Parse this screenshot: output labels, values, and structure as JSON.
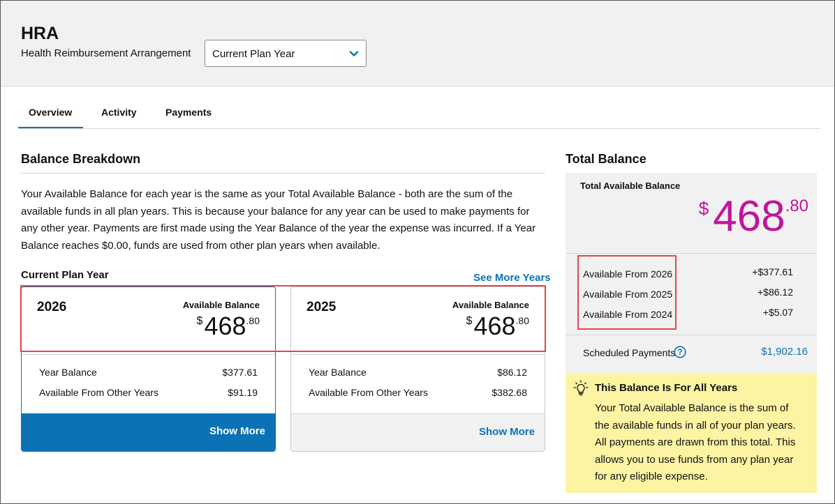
{
  "header": {
    "title": "HRA",
    "subtitle": "Health Reimbursement Arrangement",
    "plan_select": {
      "value": "Current Plan Year",
      "icon": "chevron-down-icon"
    }
  },
  "tabs": [
    {
      "label": "Overview",
      "active": true
    },
    {
      "label": "Activity",
      "active": false
    },
    {
      "label": "Payments",
      "active": false
    }
  ],
  "balance_breakdown": {
    "title": "Balance Breakdown",
    "description": "Your Available Balance for each year is the same as your Total Available Balance - both are the sum of the available funds in all plan years. This is because your balance for any year can be used to make payments for any other year. Payments are first made using the Year Balance of the year the expense was incurred. If a Year Balance reaches $0.00, funds are used from other plan years when available.",
    "current_plan_year_label": "Current Plan Year",
    "see_more_years": "See More Years",
    "cards": [
      {
        "year": "2026",
        "available_label": "Available Balance",
        "currency": "$",
        "amount_whole": "468",
        "amount_cents": ".80",
        "rows": [
          {
            "label": "Year Balance",
            "value": "$377.61"
          },
          {
            "label": "Available From Other Years",
            "value": "$91.19"
          }
        ],
        "show_more": "Show More",
        "selected": true
      },
      {
        "year": "2025",
        "available_label": "Available Balance",
        "currency": "$",
        "amount_whole": "468",
        "amount_cents": ".80",
        "rows": [
          {
            "label": "Year Balance",
            "value": "$86.12"
          },
          {
            "label": "Available From Other Years",
            "value": "$382.68"
          }
        ],
        "show_more": "Show More",
        "selected": false
      }
    ]
  },
  "total_balance": {
    "title": "Total Balance",
    "label": "Total Available Balance",
    "currency": "$",
    "amount_whole": "468",
    "amount_cents": ".80",
    "available_from": [
      {
        "label": "Available From 2026",
        "value": "+$377.61"
      },
      {
        "label": "Available From 2025",
        "value": "+$86.12"
      },
      {
        "label": "Available From 2024",
        "value": "+$5.07"
      }
    ],
    "scheduled_label": "Scheduled Payments",
    "scheduled_value": "$1,902.16",
    "help_icon": "question-circle-icon"
  },
  "notice": {
    "icon": "lightbulb-icon",
    "title": "This Balance Is For All Years",
    "body": "Your Total Available Balance is the sum of the available funds in all of your plan years. All payments are drawn from this total. This allows you to use funds from any plan year for any eligible expense."
  },
  "colors": {
    "accent": "#0b72b5",
    "total_amount": "#c0169a",
    "notice_bg": "#fcf3a3",
    "highlight": "#e0474c"
  }
}
